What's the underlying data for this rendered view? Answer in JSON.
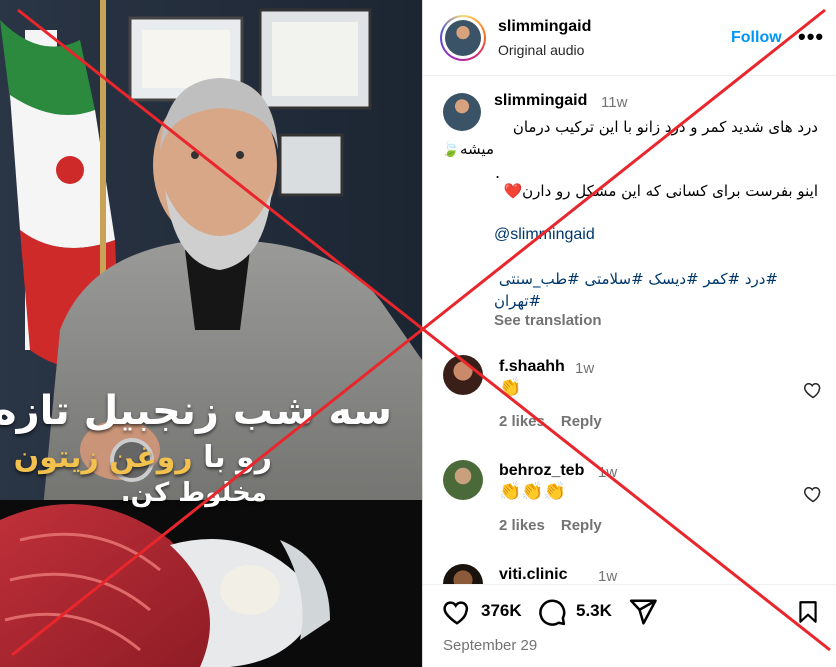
{
  "video": {
    "caption_line1": "سه شب زنجبیل تازه",
    "caption_line2a": "رو با ",
    "caption_line2b": "روغن زیتون",
    "caption_line3": "مخلوط کن."
  },
  "header": {
    "username": "slimmingaid",
    "subtitle": "Original audio",
    "follow_label": "Follow",
    "more_label": "•••"
  },
  "caption": {
    "username": "slimmingaid",
    "age": "11w",
    "line1": "درد های شدید کمر و درد زانو با این ترکیب درمان",
    "line2": "میشه🍃",
    "line3": ".",
    "line4": "اینو بفرست برای کسانی که این مشکل رو دارن❤️",
    "mention": "@slimmingaid",
    "tags_line1": "#درد #کمر #دیسک #سلامتی #طب_سنتی",
    "tags_line2": "#تهران",
    "see_translation": "See translation"
  },
  "comments": [
    {
      "username": "f.shaahh",
      "age": "1w",
      "text": "👏",
      "likes": "2 likes",
      "reply": "Reply"
    },
    {
      "username": "behroz_teb",
      "age": "1w",
      "text": "👏👏👏",
      "likes": "2 likes",
      "reply": "Reply"
    },
    {
      "username": "viti.clinic",
      "age": "1w"
    }
  ],
  "actions": {
    "likes": "376K",
    "comments": "5.3K",
    "date": "September 29"
  },
  "colors": {
    "accent": "#0095f6",
    "overlay_x": "#e8262b",
    "link": "#00376b"
  }
}
